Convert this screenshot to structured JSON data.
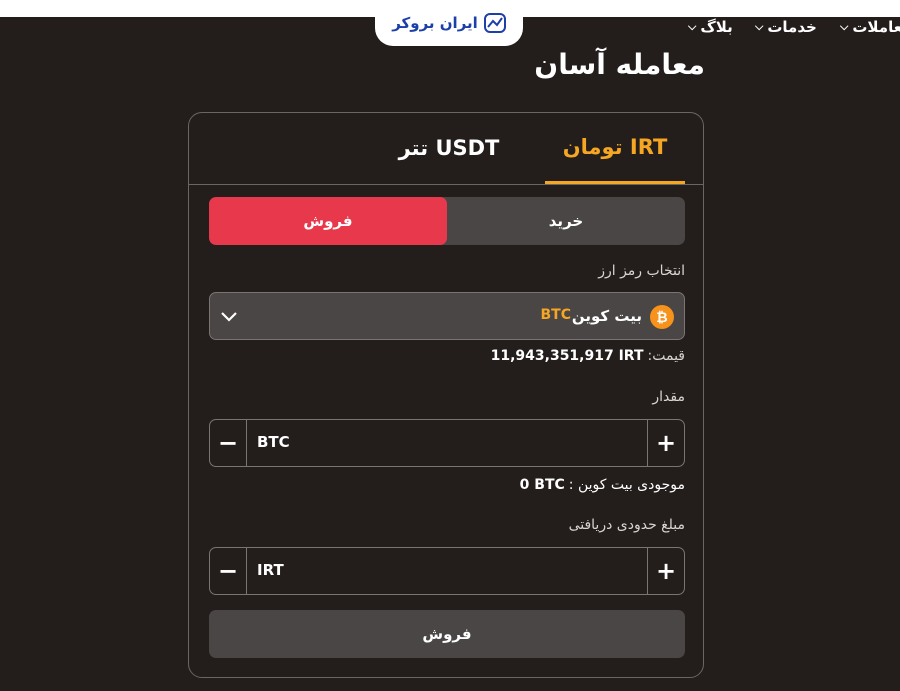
{
  "header": {
    "logo_text": "ایران بروکر",
    "nav": [
      {
        "label": "بلاگ"
      },
      {
        "label": "خدمات"
      },
      {
        "label": "معاملات"
      }
    ]
  },
  "page": {
    "title": "معامله آسان"
  },
  "card": {
    "tabs": [
      {
        "label": "تومان IRT",
        "active": true
      },
      {
        "label": "تتر USDT",
        "active": false
      }
    ],
    "side": {
      "buy_label": "خرید",
      "sell_label": "فروش",
      "selected": "sell"
    },
    "select_label": "انتخاب رمز ارز",
    "selected_coin": {
      "name": "بیت کوین",
      "symbol": "BTC",
      "icon": "bitcoin-icon"
    },
    "price": {
      "label": "قیمت:",
      "value": "11,943,351,917 IRT"
    },
    "amount": {
      "label": "مقدار",
      "unit": "BTC",
      "minus": "−",
      "plus": "+"
    },
    "balance": {
      "label": "موجودی بیت کوین :",
      "value": "0 BTC"
    },
    "receive": {
      "label": "مبلغ حدودی دریافتی",
      "unit": "IRT",
      "minus": "−",
      "plus": "+"
    },
    "submit_label": "فروش"
  },
  "colors": {
    "background": "#231d1c",
    "accent": "#f5a623",
    "sell": "#e8384b",
    "control": "#4a4646"
  }
}
